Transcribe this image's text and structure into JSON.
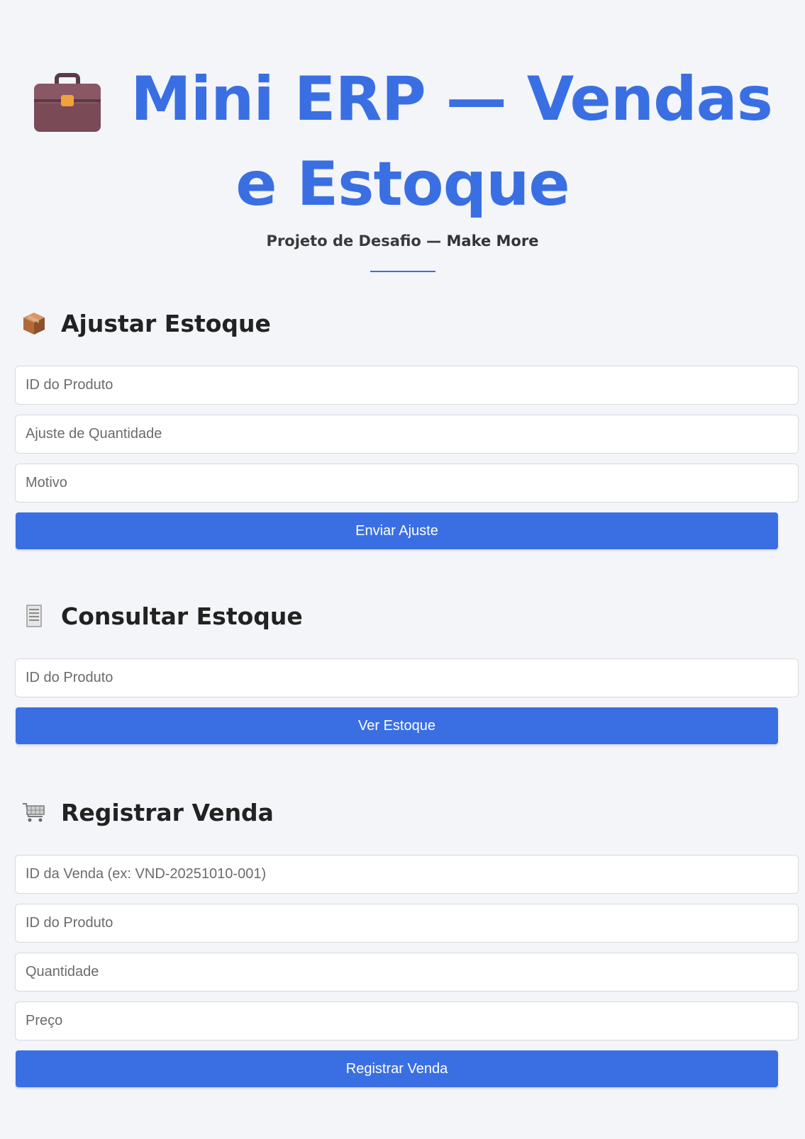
{
  "header": {
    "title_line1": "Mini ERP — Vendas",
    "title_line2": "e Estoque",
    "subtitle_prefix": "Projeto de Desafio — ",
    "subtitle_brand": "Make More",
    "icon": "briefcase-icon"
  },
  "sections": {
    "adjust": {
      "icon": "package-icon",
      "title": "Ajustar Estoque",
      "fields": {
        "product_id": "ID do Produto",
        "quantity": "Ajuste de Quantidade",
        "reason": "Motivo"
      },
      "button": "Enviar Ajuste"
    },
    "query": {
      "icon": "receipt-icon",
      "title": "Consultar Estoque",
      "fields": {
        "product_id": "ID do Produto"
      },
      "button": "Ver Estoque"
    },
    "sale": {
      "icon": "cart-icon",
      "title": "Registrar Venda",
      "fields": {
        "sale_id": "ID da Venda (ex: VND-20251010-001)",
        "product_id": "ID do Produto",
        "quantity": "Quantidade",
        "price": "Preço"
      },
      "button": "Registrar Venda"
    }
  },
  "colors": {
    "accent": "#3a6fe3",
    "background": "#f3f5f9",
    "heading": "#222222"
  }
}
